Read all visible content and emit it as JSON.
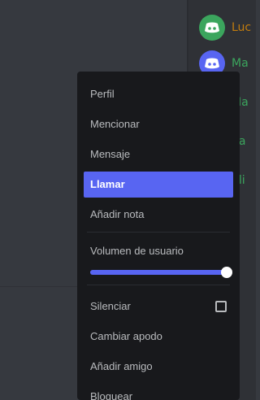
{
  "colors": {
    "menu_bg": "#18191c",
    "accent": "#5865f2",
    "text": "#b9bbbe",
    "chat_bg": "#36393f",
    "members_bg": "#2f3136"
  },
  "members": [
    {
      "name": "Luc",
      "avatar_color": "#3ba55d",
      "name_color": "#c27c0e",
      "icon": "discord-logo-icon"
    },
    {
      "name": "Ma",
      "avatar_color": "#5865f2",
      "name_color": "#3ba55d",
      "icon": "discord-logo-icon"
    },
    {
      "name": "Ma",
      "avatar_color": null,
      "name_color": "#3ba55d"
    },
    {
      "name": "Sa",
      "avatar_color": null,
      "name_color": "#3ba55d"
    },
    {
      "name": "Sli",
      "avatar_color": null,
      "name_color": "#3ba55d"
    }
  ],
  "context_menu": {
    "items_top": [
      {
        "label": "Perfil",
        "active": false
      },
      {
        "label": "Mencionar",
        "active": false
      },
      {
        "label": "Mensaje",
        "active": false
      },
      {
        "label": "Llamar",
        "active": true
      },
      {
        "label": "Añadir nota",
        "active": false
      }
    ],
    "volume": {
      "label": "Volumen de usuario",
      "level_percent": 100
    },
    "items_bottom": [
      {
        "label": "Silenciar",
        "has_checkbox": true,
        "checked": false
      },
      {
        "label": "Cambiar apodo"
      },
      {
        "label": "Añadir amigo"
      },
      {
        "label": "Bloquear"
      }
    ]
  }
}
